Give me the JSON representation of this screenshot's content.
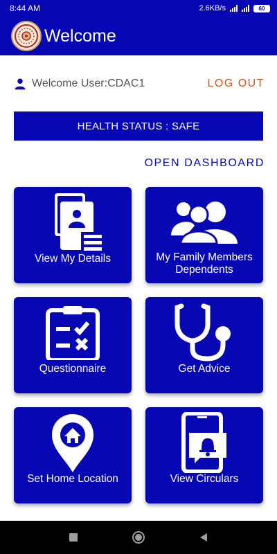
{
  "status_bar": {
    "time": "8:44 AM",
    "speed": "2.6KB/s",
    "battery": "60"
  },
  "app_bar": {
    "title": "Welcome"
  },
  "user": {
    "welcome_text": "Welcome User:CDAC1",
    "logout_label": "LOG OUT"
  },
  "health_status": "HEALTH STATUS : SAFE",
  "open_dashboard_label": "OPEN DASHBOARD",
  "tiles": [
    {
      "label": "View My Details",
      "icon": "id-card-icon"
    },
    {
      "label": "My Family Members Dependents",
      "icon": "family-icon"
    },
    {
      "label": "Questionnaire",
      "icon": "clipboard-icon"
    },
    {
      "label": "Get Advice",
      "icon": "stethoscope-icon"
    },
    {
      "label": "Set Home Location",
      "icon": "home-location-icon"
    },
    {
      "label": "View Circulars",
      "icon": "phone-notification-icon"
    }
  ],
  "colors": {
    "primary": "#0707b4",
    "accent": "#d3531a",
    "nav_bar": "#000000"
  }
}
